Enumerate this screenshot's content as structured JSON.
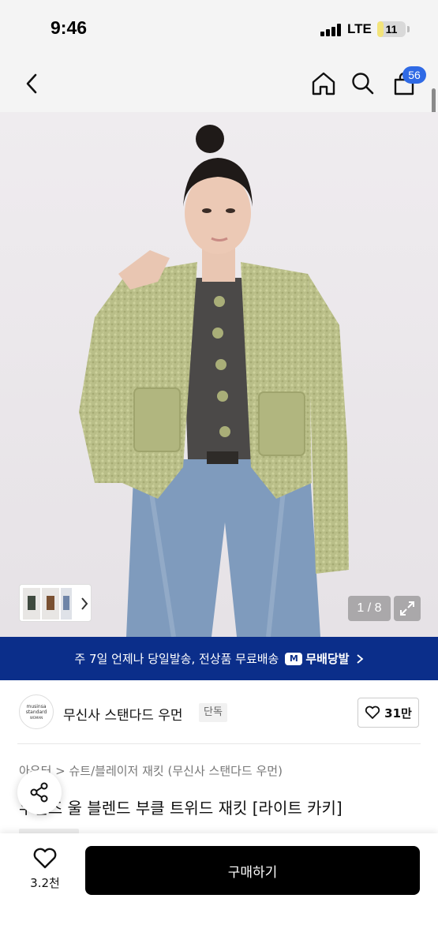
{
  "status_bar": {
    "time": "9:46",
    "network": "LTE",
    "battery_level": "11",
    "battery_fraction": 0.11
  },
  "nav": {
    "back_icon": "chevron-left-icon",
    "home_icon": "home-icon",
    "search_icon": "search-icon",
    "cart_icon": "shopping-bag-icon",
    "cart_count": "56"
  },
  "gallery": {
    "counter": "1 / 8",
    "expand_icon": "expand-icon"
  },
  "promo": {
    "text": "주 7일 언제나 당일발송, 전상품 무료배송",
    "brand_label": "무배당발",
    "logo_mark": "M"
  },
  "brand": {
    "logo_line1": "musinsa",
    "logo_line2": "standard",
    "logo_line3": "WOMAN",
    "name": "무신사 스탠다드 우먼",
    "tag": "단독",
    "likes": "31만"
  },
  "product": {
    "breadcrumb": "아우터 > 슈트/블레이저 재킷 (무신사 스탠다드 우먼)",
    "title": "우먼즈 울 블렌드 부클 트위드 재킷 [라이트 카키]"
  },
  "bottom_bar": {
    "wish_count": "3.2천",
    "buy_label": "구매하기"
  },
  "colors": {
    "promo_bg": "#0b2e8a",
    "badge": "#2f6ae5",
    "buy_button": "#000000",
    "jacket": "#b8bd86"
  }
}
